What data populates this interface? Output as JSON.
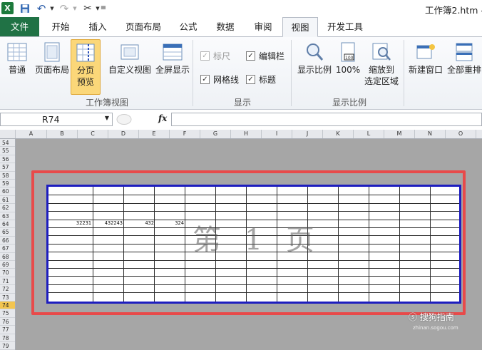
{
  "window": {
    "title": "工作簿2.htm -"
  },
  "tabs": [
    "文件",
    "开始",
    "插入",
    "页面布局",
    "公式",
    "数据",
    "审阅",
    "视图",
    "开发工具"
  ],
  "active_tab": "视图",
  "ribbon": {
    "workbook_views": {
      "label": "工作簿视图",
      "normal": "普通",
      "page_layout": "页面布局",
      "page_break_1": "分页",
      "page_break_2": "预览",
      "custom_view": "自定义视图",
      "full_screen": "全屏显示"
    },
    "show": {
      "label": "显示",
      "ruler": "标尺",
      "formula_bar": "编辑栏",
      "gridlines": "网格线",
      "headings": "标题",
      "ruler_checked": true,
      "formula_bar_checked": true,
      "gridlines_checked": true,
      "headings_checked": true
    },
    "zoom": {
      "label": "显示比例",
      "zoom": "显示比例",
      "hundred": "100%",
      "zoom_sel_1": "缩放到",
      "zoom_sel_2": "选定区域"
    },
    "window": {
      "new_window": "新建窗口",
      "arrange_all": "全部重排"
    }
  },
  "formula_bar": {
    "name_box": "R74",
    "fx": "fx",
    "value": ""
  },
  "columns": [
    "A",
    "B",
    "C",
    "D",
    "E",
    "F",
    "G",
    "H",
    "I",
    "J",
    "K",
    "L",
    "M",
    "N",
    "O"
  ],
  "rows": [
    "54",
    "55",
    "56",
    "57",
    "58",
    "59",
    "60",
    "61",
    "62",
    "63",
    "64",
    "65",
    "66",
    "67",
    "68",
    "69",
    "70",
    "71",
    "72",
    "73",
    "74",
    "75",
    "76",
    "77",
    "78",
    "79"
  ],
  "selected_row": "74",
  "cells": {
    "b64": "32231",
    "c64": "432243",
    "d64": "432",
    "e64": "324"
  },
  "page_watermark": "第 1 页",
  "brand": {
    "name": "搜狗指南",
    "url": "zhinan.sogou.com"
  },
  "colors": {
    "file_tab": "#207245",
    "page_border": "#1d1dbf",
    "highlight_box": "#e84a4a",
    "selected_row": "#f3c54f"
  }
}
